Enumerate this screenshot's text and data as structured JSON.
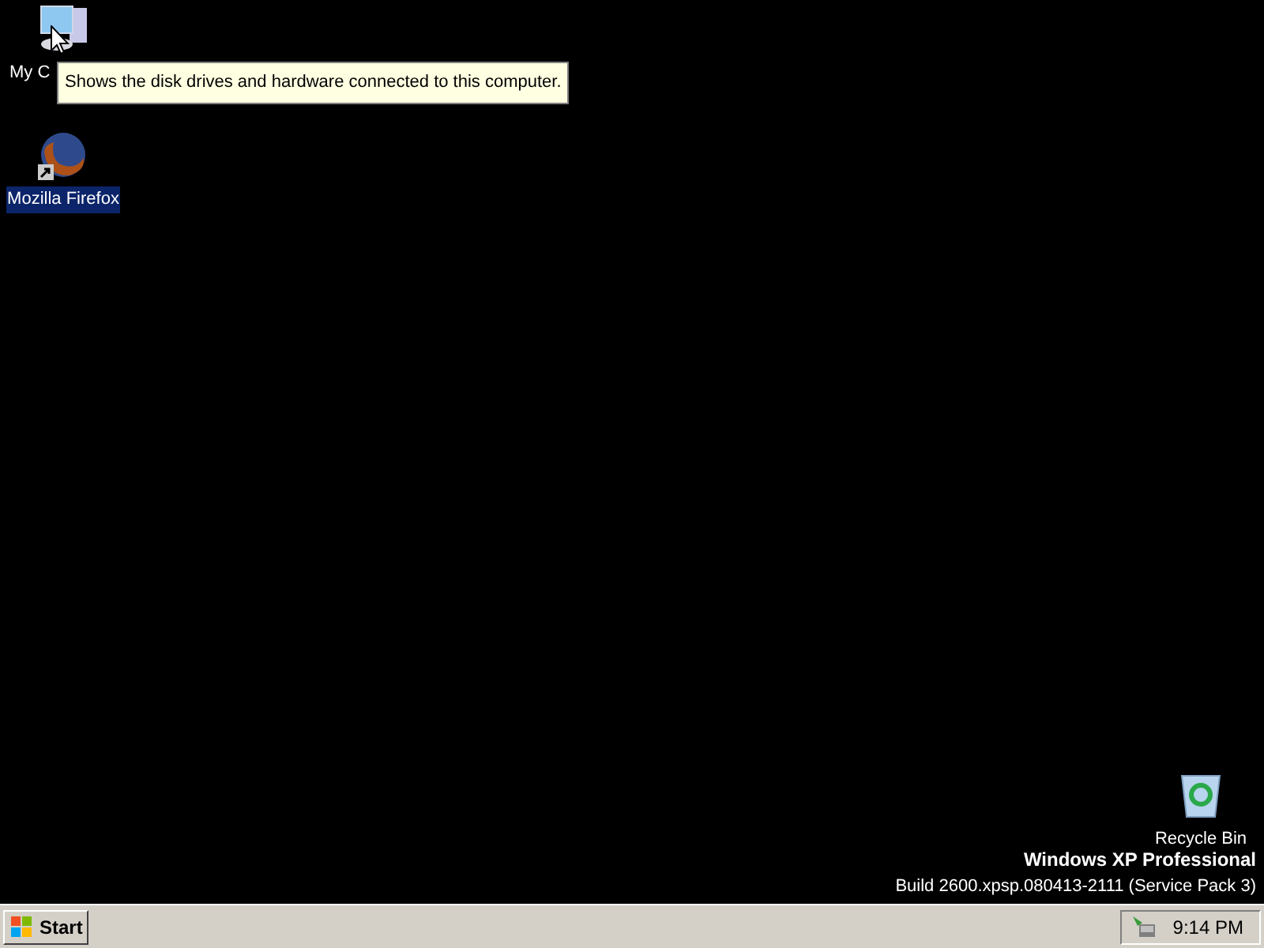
{
  "desktop_icons": [
    {
      "kind": "computer",
      "label": "My C",
      "selected": false,
      "shortcut": false
    },
    {
      "kind": "firefox",
      "label": "Mozilla Firefox",
      "selected": true,
      "shortcut": true
    },
    {
      "kind": "recycle_bin",
      "label": "Recycle Bin",
      "selected": false,
      "shortcut": false
    }
  ],
  "tooltip": {
    "text": "Shows the disk drives and hardware connected to this computer."
  },
  "edition": {
    "title": "Windows XP Professional",
    "build": "Build 2600.xpsp.080413-2111 (Service Pack 3)"
  },
  "taskbar": {
    "start_label": "Start",
    "clock": "9:14 PM"
  }
}
